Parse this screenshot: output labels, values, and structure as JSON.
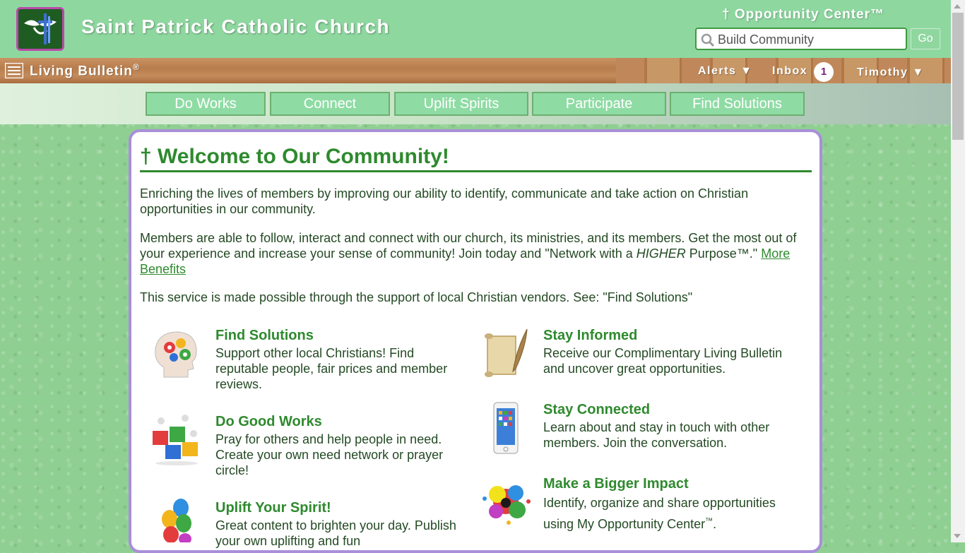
{
  "header": {
    "site_title": "Saint Patrick Catholic Church",
    "opportunity_title": "† Opportunity Center™",
    "search_value": "Build Community",
    "go_label": "Go"
  },
  "woodbar": {
    "living_bulletin": "Living Bulletin",
    "registered": "®",
    "alerts": "Alerts ▼",
    "inbox": "Inbox",
    "inbox_count": "1",
    "user": "Timothy ▼"
  },
  "nav": [
    "Do Works",
    "Connect",
    "Uplift Spirits",
    "Participate",
    "Find Solutions"
  ],
  "main": {
    "welcome": "† Welcome to Our Community!",
    "p1": "Enriching the lives of members by improving our ability to identify, communicate and take action on Christian opportunities in our community.",
    "p2_a": "Members are able to follow, interact and connect with our church, its ministries, and its members. Get the most out of your experience and increase your sense of community! Join today and \"Network with a ",
    "p2_em": "HIGHER",
    "p2_b": " Purpose™.\" ",
    "p2_link": "More Benefits",
    "p3": "This service is made possible through the support of local Christian vendors. See: \"Find Solutions\""
  },
  "features": {
    "find_solutions": {
      "title": "Find Solutions",
      "desc": "Support other local Christians! Find reputable people, fair prices and member reviews."
    },
    "do_good_works": {
      "title": "Do Good Works",
      "desc": "Pray for others and help people in need. Create your own need network or prayer circle!"
    },
    "uplift_spirit": {
      "title": "Uplift Your Spirit!",
      "desc": "Great content to brighten your day. Publish your own uplifting and fun"
    },
    "stay_informed": {
      "title": "Stay Informed",
      "desc": "Receive our Complimentary Living Bulletin and uncover great opportunities."
    },
    "stay_connected": {
      "title": "Stay Connected",
      "desc": "Learn about and stay in touch with other members. Join the conversation."
    },
    "bigger_impact": {
      "title": "Make a Bigger Impact",
      "desc": "Identify, organize and share opportunities using My Opportunity Center",
      "tm": "™",
      "end": "."
    }
  },
  "colors": {
    "accent_green": "#2e8a2e",
    "panel_border": "#a98fd9",
    "header_green": "#8ed8a0"
  }
}
